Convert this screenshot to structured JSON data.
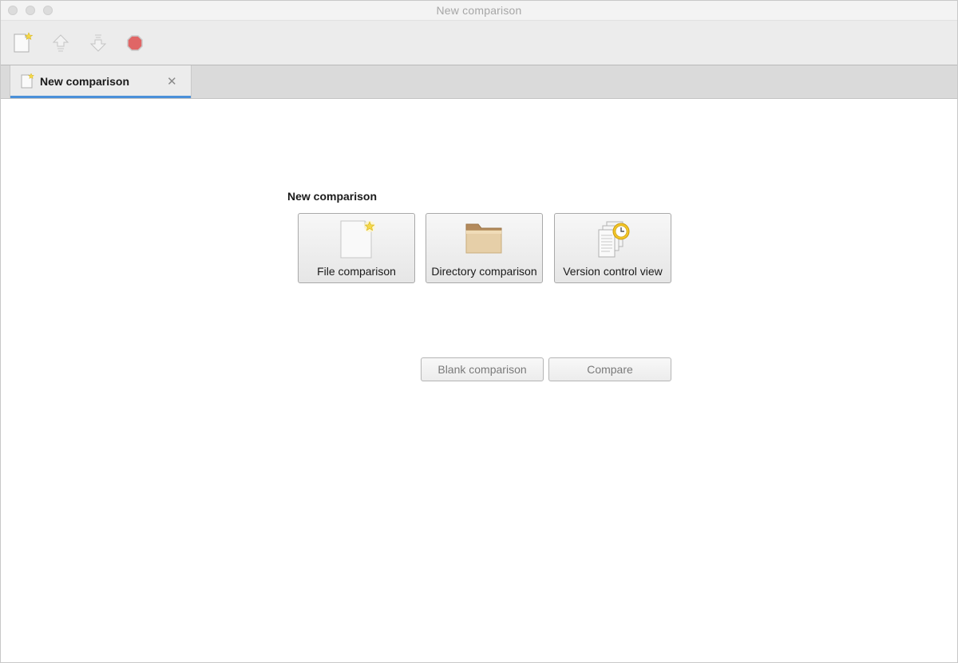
{
  "window": {
    "title": "New comparison"
  },
  "toolbar": {
    "buttons": [
      {
        "icon": "new-document-icon",
        "label": ""
      },
      {
        "icon": "up-arrow-icon",
        "label": ""
      },
      {
        "icon": "down-arrow-icon",
        "label": ""
      },
      {
        "icon": "stop-icon",
        "label": ""
      }
    ]
  },
  "tabs": [
    {
      "label": "New comparison",
      "icon": "new-document-icon",
      "active": true,
      "close_glyph": "✕"
    }
  ],
  "main": {
    "section_title": "New comparison",
    "options": [
      {
        "label": "File comparison",
        "icon": "new-file-icon"
      },
      {
        "label": "Directory comparison",
        "icon": "folder-icon"
      },
      {
        "label": "Version control view",
        "icon": "version-control-icon"
      }
    ],
    "actions": {
      "blank_label": "Blank comparison",
      "compare_label": "Compare"
    }
  },
  "colors": {
    "accent": "#4a90d9",
    "stop": "#e06666",
    "folder": "#d9b98a",
    "clock": "#e0b020"
  }
}
